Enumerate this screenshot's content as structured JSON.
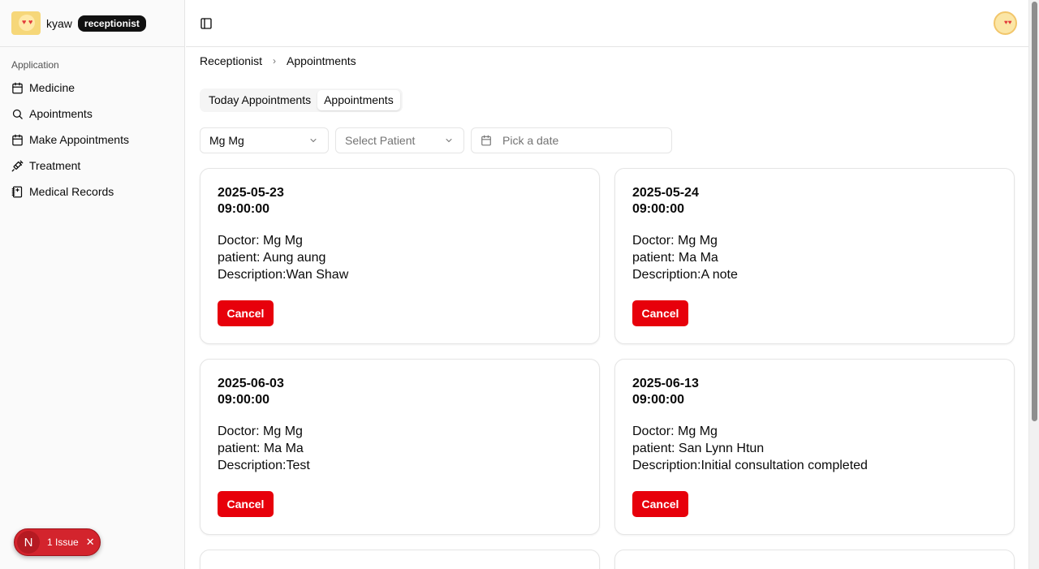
{
  "user": {
    "name": "kyaw",
    "role": "receptionist"
  },
  "sidebar": {
    "group_label": "Application",
    "items": [
      {
        "label": "Medicine",
        "icon": "calendar-icon"
      },
      {
        "label": "Apointments",
        "icon": "search-icon"
      },
      {
        "label": "Make Appointments",
        "icon": "calendar-icon"
      },
      {
        "label": "Treatment",
        "icon": "syringe-icon"
      },
      {
        "label": "Medical Records",
        "icon": "notebook-icon"
      }
    ]
  },
  "issue_badge": {
    "logo": "N",
    "label": "1 Issue"
  },
  "breadcrumb": {
    "parent": "Receptionist",
    "current": "Appointments"
  },
  "tabs": [
    {
      "label": "Today Appointments",
      "active": false
    },
    {
      "label": "Appointments",
      "active": true
    }
  ],
  "filters": {
    "doctor": "Mg Mg",
    "patient_placeholder": "Select Patient",
    "date_placeholder": "Pick a date"
  },
  "appointments": [
    {
      "date": "2025-05-23",
      "time": "09:00:00",
      "doctor": "Doctor: Mg Mg",
      "patient": "patient: Aung aung",
      "description": "Description:Wan Shaw",
      "cancel_label": "Cancel"
    },
    {
      "date": "2025-05-24",
      "time": "09:00:00",
      "doctor": "Doctor: Mg Mg",
      "patient": "patient: Ma Ma",
      "description": "Description:A note",
      "cancel_label": "Cancel"
    },
    {
      "date": "2025-06-03",
      "time": "09:00:00",
      "doctor": "Doctor: Mg Mg",
      "patient": "patient: Ma Ma",
      "description": "Description:Test",
      "cancel_label": "Cancel"
    },
    {
      "date": "2025-06-13",
      "time": "09:00:00",
      "doctor": "Doctor: Mg Mg",
      "patient": "patient: San Lynn Htun",
      "description": "Description:Initial consultation completed",
      "cancel_label": "Cancel"
    }
  ],
  "colors": {
    "cancel": "#e7000b",
    "badge": "#111111",
    "issue": "#d3242d"
  }
}
